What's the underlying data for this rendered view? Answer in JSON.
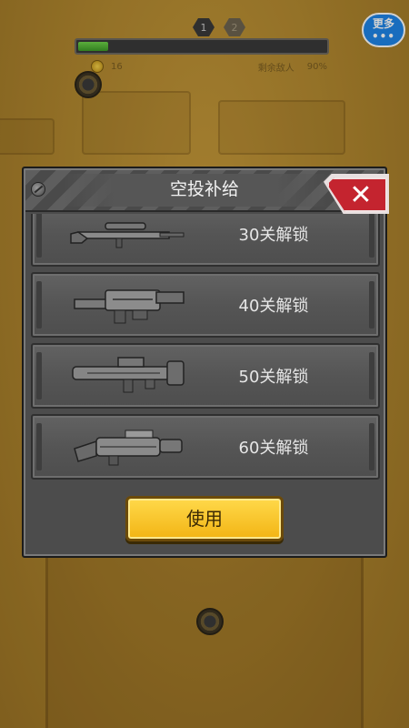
{
  "hud": {
    "wave_badges": [
      "1",
      "2"
    ],
    "progress": 0.12,
    "coin_count": "16",
    "enemies_label": "剩余敌人",
    "enemies_value": "90%"
  },
  "more_button": {
    "label": "更多",
    "dots": "•••"
  },
  "dialog": {
    "title": "空投补给",
    "close_icon": "✕",
    "items": [
      {
        "weapon_icon": "sniper-rifle-icon",
        "unlock_text": "30关解锁"
      },
      {
        "weapon_icon": "heavy-rifle-icon",
        "unlock_text": "40关解锁"
      },
      {
        "weapon_icon": "rocket-launcher-icon",
        "unlock_text": "50关解锁"
      },
      {
        "weapon_icon": "plasma-rifle-icon",
        "unlock_text": "60关解锁"
      }
    ],
    "use_button": "使用"
  },
  "colors": {
    "accent_yellow": "#f2b414",
    "close_red": "#c4242f",
    "more_blue": "#1f86e8",
    "progress_green": "#4fb534"
  }
}
